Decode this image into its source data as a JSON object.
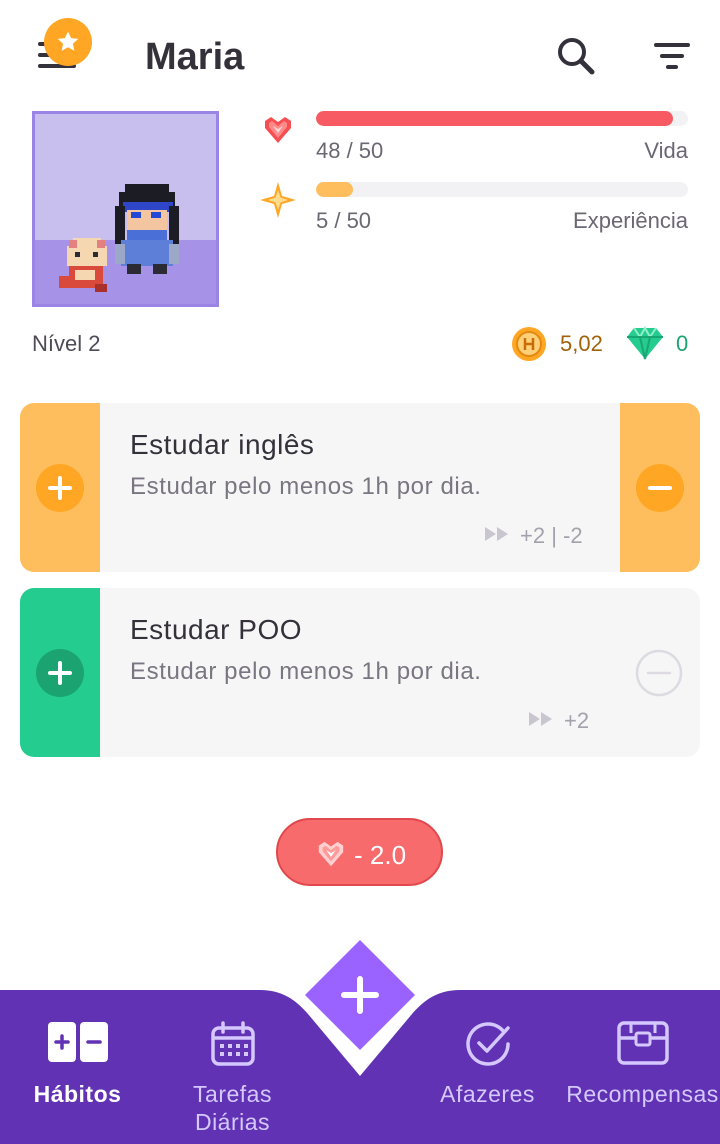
{
  "header": {
    "user_name": "Maria",
    "menu_icon": "hamburger-icon",
    "badge_icon": "star-icon",
    "search_icon": "search-icon",
    "filter_icon": "filter-icon"
  },
  "stats": {
    "health": {
      "value_text": "48 / 50",
      "label": "Vida",
      "fraction": 0.96,
      "color": "#f75a62"
    },
    "experience": {
      "value_text": "5 / 50",
      "label": "Experiência",
      "fraction": 0.1,
      "color": "#ffbe5d"
    },
    "level": "Nível 2",
    "gold": "5,02",
    "gems": "0"
  },
  "habits": [
    {
      "title": "Estudar inglês",
      "notes": "Estudar pelo menos 1h por dia.",
      "streak": "+2 | -2",
      "color": "#ffbe5d"
    },
    {
      "title": "Estudar POO",
      "notes": "Estudar pelo menos 1h por dia.",
      "streak": "+2",
      "color": "#24cc8f"
    }
  ],
  "toast": {
    "text": "- 2.0",
    "icon": "heart-icon"
  },
  "nav": {
    "items": [
      {
        "label": "Hábitos",
        "icon": "habits-icon",
        "active": true
      },
      {
        "label": "Tarefas Diárias",
        "icon": "calendar-icon",
        "active": false
      },
      {
        "label": "Afazeres",
        "icon": "check-circle-icon",
        "active": false
      },
      {
        "label": "Recompensas",
        "icon": "chest-icon",
        "active": false
      }
    ],
    "fab_icon": "plus-icon",
    "background_color": "#6133b4"
  }
}
